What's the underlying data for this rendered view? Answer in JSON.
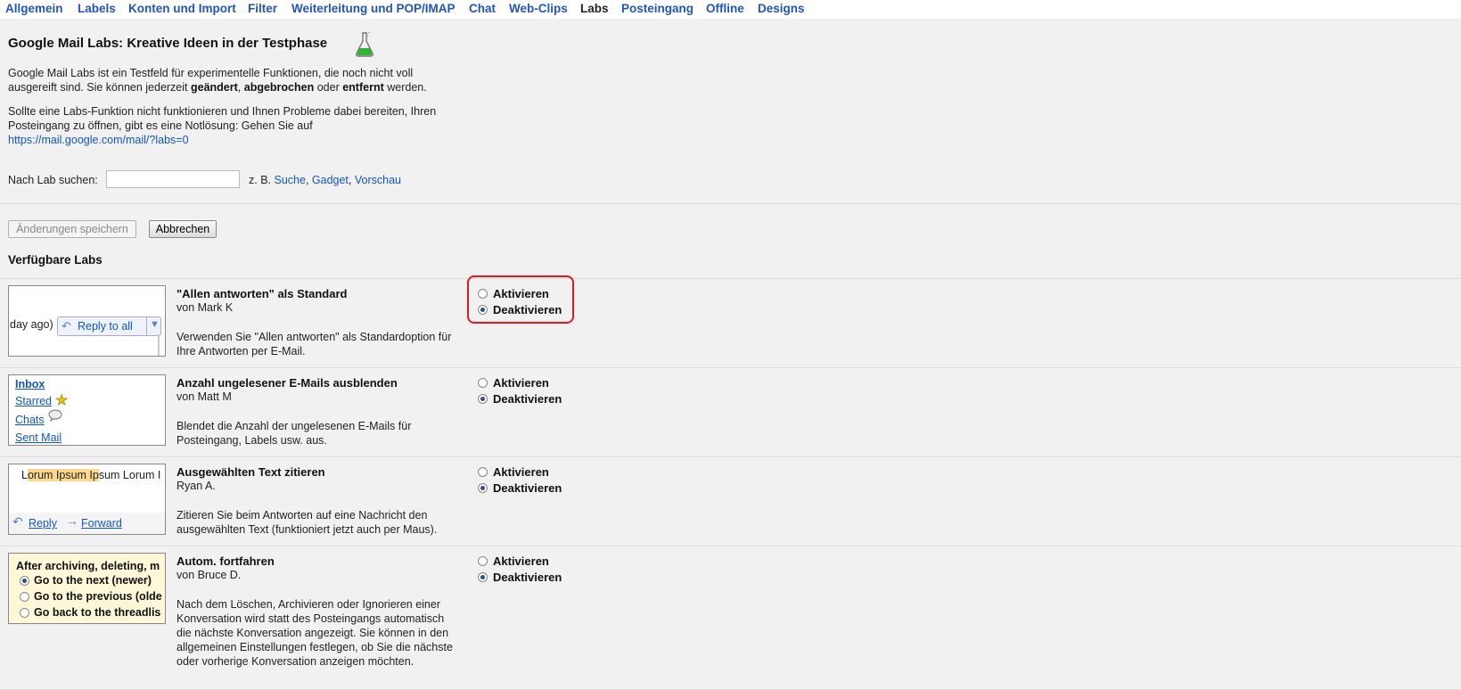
{
  "tabs": [
    {
      "label": "Allgemein"
    },
    {
      "label": "Labels"
    },
    {
      "label": "Konten und Import"
    },
    {
      "label": "Filter"
    },
    {
      "label": "Weiterleitung und POP/IMAP"
    },
    {
      "label": "Chat"
    },
    {
      "label": "Web-Clips"
    },
    {
      "label": "Labs"
    },
    {
      "label": "Posteingang"
    },
    {
      "label": "Offline"
    },
    {
      "label": "Designs"
    }
  ],
  "header": {
    "title": "Google Mail Labs: Kreative Ideen in der Testphase",
    "intro_1": "Google Mail Labs ist ein Testfeld für experimentelle Funktionen, die noch nicht voll ausgereift sind. Sie können jederzeit ",
    "intro_b1": "geändert",
    "intro_2": ", ",
    "intro_b2": "abgebrochen",
    "intro_3": " oder ",
    "intro_b3": "entfernt",
    "intro_4": " werden.",
    "fallback_text": "Sollte eine Labs-Funktion nicht funktionieren und Ihnen Probleme dabei bereiten, Ihren Posteingang zu öffnen, gibt es eine Notlösung: Gehen Sie auf",
    "fallback_link": "https://mail.google.com/mail/?labs=0"
  },
  "search": {
    "label": "Nach Lab suchen:",
    "value": "",
    "hint_prefix": "z. B. ",
    "examples": [
      "Suche",
      "Gadget",
      "Vorschau"
    ],
    "comma": ", "
  },
  "actions": {
    "save_label": "Änderungen speichern",
    "cancel_label": "Abbrechen"
  },
  "section_title": "Verfügbare Labs",
  "option_labels": {
    "enable": "Aktivieren",
    "disable": "Deaktivieren"
  },
  "labs": [
    {
      "name": "\"Allen antworten\" als Standard",
      "author": "von Mark K",
      "description": "Verwenden Sie \"Allen antworten\" als Standardoption für Ihre Antworten per E-Mail.",
      "selected": "Deaktivieren",
      "preview": {
        "fragment": "day ago)",
        "button": "Reply to all"
      }
    },
    {
      "name": "Anzahl ungelesener E-Mails ausblenden",
      "author": "von Matt M",
      "description": "Blendet die Anzahl der ungelesenen E-Mails für Posteingang, Labels usw. aus.",
      "selected": "Deaktivieren",
      "preview": {
        "links": [
          "Inbox",
          "Starred",
          "Chats",
          "Sent Mail"
        ]
      }
    },
    {
      "name": "Ausgewählten Text zitieren",
      "author": "Ryan A.",
      "description": "Zitieren Sie beim Antworten auf eine Nachricht den ausgewählten Text (funktioniert jetzt auch per Maus).",
      "selected": "Deaktivieren",
      "preview": {
        "text_pre": "L",
        "text_hl": "orum Ipsum Ip",
        "text_post": "sum Lorum I",
        "reply": "Reply",
        "forward": "Forward"
      }
    },
    {
      "name": "Autom. fortfahren",
      "author": "von Bruce D.",
      "description": "Nach dem Löschen, Archivieren oder Ignorieren einer Konversation wird statt des Posteingangs automatisch die nächste Konversation angezeigt. Sie können in den allgemeinen Einstellungen festlegen, ob Sie die nächste oder vorherige Konversation anzeigen möchten.",
      "selected": "Deaktivieren",
      "preview": {
        "heading": "After archiving, deleting, m",
        "options": [
          "Go to the next (newer)",
          "Go to the previous (olde",
          "Go back to the threadlis"
        ]
      }
    }
  ],
  "colors": {
    "link": "#1155cc",
    "highlight_border": "#e01b1b",
    "preview_yellow": "#fff8d8"
  }
}
